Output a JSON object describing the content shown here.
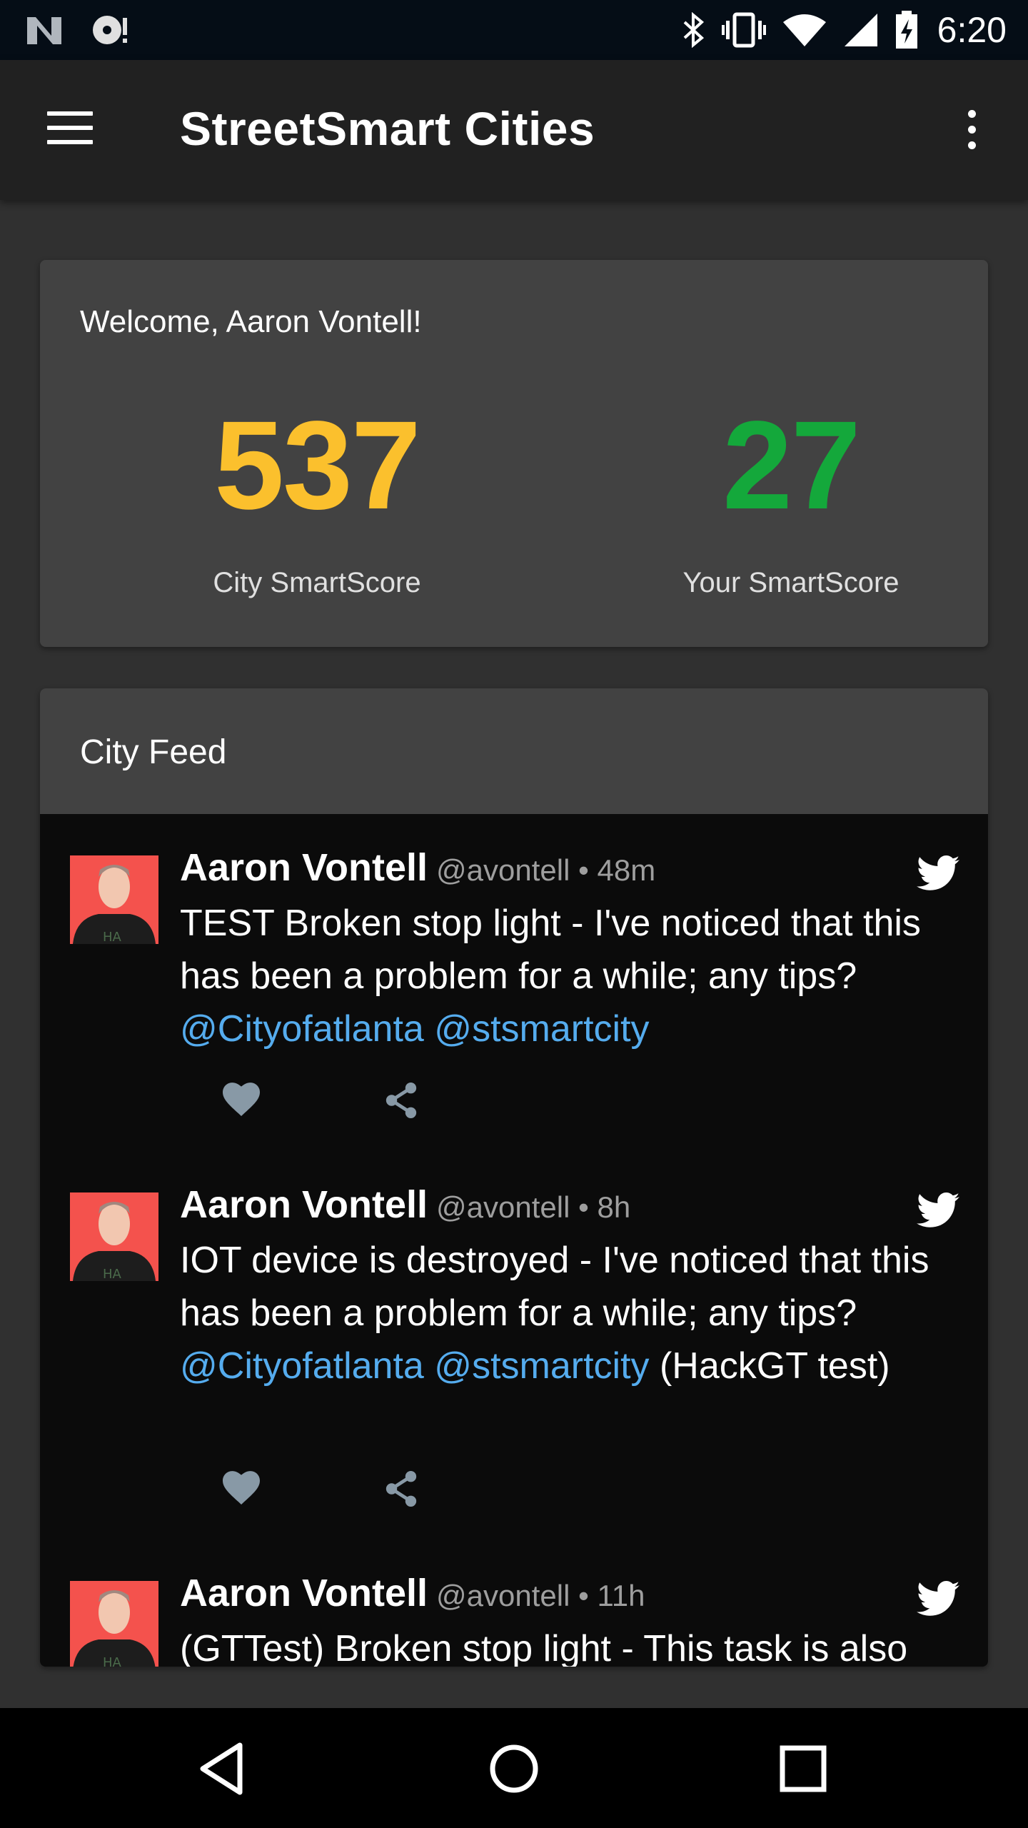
{
  "status_bar": {
    "time": "6:20",
    "left_icons": [
      "n-logo-icon",
      "media-notification-icon"
    ],
    "right_icons": [
      "bluetooth-icon",
      "vibrate-icon",
      "wifi-icon",
      "cell-signal-icon",
      "battery-charging-icon"
    ]
  },
  "app_bar": {
    "title": "StreetSmart Cities",
    "menu_icon": "hamburger-menu-icon",
    "overflow_icon": "more-vertical-icon"
  },
  "welcome_card": {
    "greeting": "Welcome, Aaron Vontell!",
    "city_score": {
      "value": "537",
      "label": "City SmartScore",
      "color": "#fbc02d"
    },
    "your_score": {
      "value": "27",
      "label": "Your SmartScore",
      "color": "#14a83b"
    }
  },
  "feed": {
    "title": "City Feed",
    "tweets": [
      {
        "name": "Aaron Vontell",
        "handle": "@avontell",
        "time": "48m",
        "text_pre": "TEST Broken stop light - I've noticed that this has been a problem for a while; any tips? ",
        "mention1": "@Cityofatlanta",
        "mention2": "@stsmartcity",
        "text_post": ""
      },
      {
        "name": "Aaron Vontell",
        "handle": "@avontell",
        "time": "8h",
        "text_pre": "IOT device is destroyed - I've noticed that this has been a problem for a while; any tips?",
        "mention1": "@Cityofatlanta",
        "mention2": "@stsmartcity",
        "text_post": " (HackGT test)"
      },
      {
        "name": "Aaron Vontell",
        "handle": "@avontell",
        "time": "11h",
        "text_pre": "(GTTest) Broken stop light - This task is also",
        "mention1": "",
        "mention2": "",
        "text_post": ""
      }
    ],
    "separator": " • ",
    "colors": {
      "mention": "#55acee",
      "twitter_bird": "#ffffff",
      "action_icons": "#8899a6"
    }
  },
  "nav_bar": {
    "icons": [
      "back-icon",
      "home-icon",
      "recents-icon"
    ]
  }
}
